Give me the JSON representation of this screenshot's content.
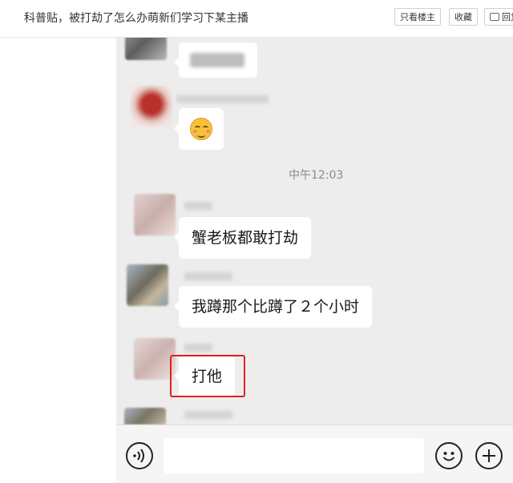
{
  "header": {
    "title": "科普贴，被打劫了怎么办萌新们学习下某主播",
    "only_louzhu_label": "只看楼主",
    "favorite_label": "收藏",
    "reply_label": "回复"
  },
  "chat": {
    "timestamp": "中午12:03",
    "messages": [
      {
        "text": "蟹老板都敢打劫"
      },
      {
        "text": "我蹲那个比蹲了２个小时"
      },
      {
        "text": "打他"
      }
    ]
  },
  "input": {
    "value": "",
    "placeholder": ""
  },
  "icons": {
    "reply": "message-icon",
    "voice": "voice-icon",
    "emoji": "emoji-icon",
    "plus": "plus-icon",
    "emoji_sticker": "smiling-emoji"
  },
  "colors": {
    "chat_background": "#ededed",
    "bubble": "#ffffff",
    "highlight_box": "#e02020"
  }
}
